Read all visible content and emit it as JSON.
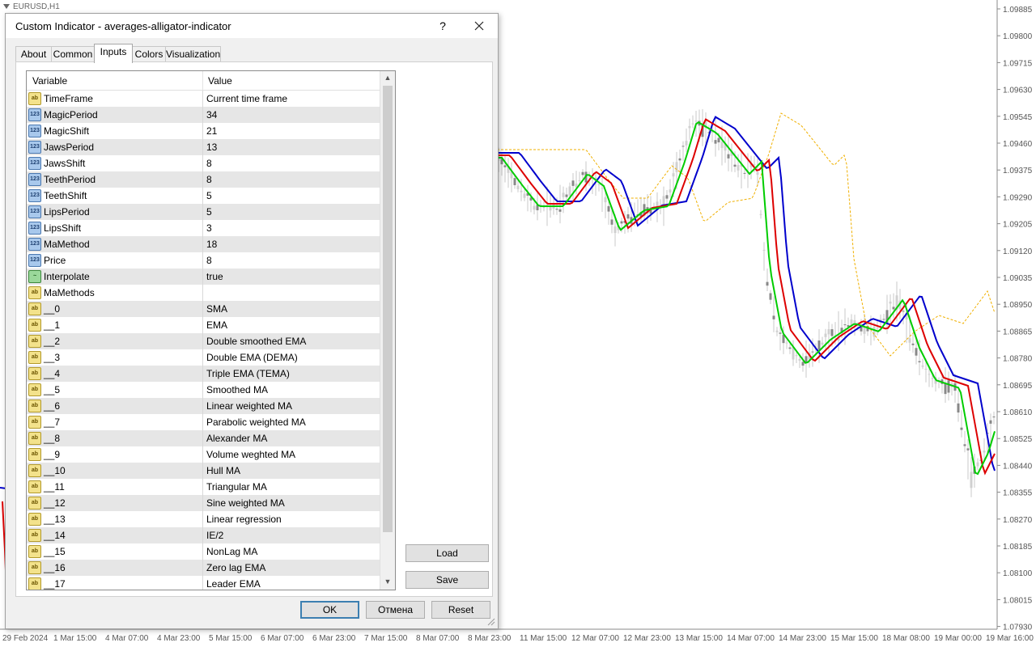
{
  "chart": {
    "symbol": "EURUSD,H1",
    "price_labels": [
      "1.09885",
      "1.09800",
      "1.09715",
      "1.09630",
      "1.09545",
      "1.09460",
      "1.09375",
      "1.09290",
      "1.09205",
      "1.09120",
      "1.09035",
      "1.08950",
      "1.08865",
      "1.08780",
      "1.08695",
      "1.08610",
      "1.08525",
      "1.08440",
      "1.08355",
      "1.08270",
      "1.08185",
      "1.08100",
      "1.08015",
      "1.07930"
    ],
    "time_labels": [
      "29 Feb 2024",
      "1 Mar 15:00",
      "4 Mar 07:00",
      "4 Mar 23:00",
      "5 Mar 15:00",
      "6 Mar 07:00",
      "6 Mar 23:00",
      "7 Mar 15:00",
      "8 Mar 07:00",
      "8 Mar 23:00",
      "11 Mar 15:00",
      "12 Mar 07:00",
      "12 Mar 23:00",
      "13 Mar 15:00",
      "14 Mar 07:00",
      "14 Mar 23:00",
      "15 Mar 15:00",
      "18 Mar 08:00",
      "19 Mar 00:00",
      "19 Mar 16:00"
    ],
    "colors": {
      "slow": "#0000cc",
      "mid": "#dd0000",
      "fast": "#00cc00",
      "band": "#f0b000",
      "candles": "#808080"
    }
  },
  "dialog": {
    "title": "Custom Indicator - averages-alligator-indicator",
    "help_label": "?",
    "tabs": [
      "About",
      "Common",
      "Inputs",
      "Colors",
      "Visualization"
    ],
    "active_tab": "Inputs",
    "columns": {
      "variable": "Variable",
      "value": "Value"
    },
    "params": [
      {
        "icon": "ab",
        "name": "TimeFrame",
        "value": "Current time frame"
      },
      {
        "icon": "123",
        "name": "MagicPeriod",
        "value": "34"
      },
      {
        "icon": "123",
        "name": "MagicShift",
        "value": "21"
      },
      {
        "icon": "123",
        "name": "JawsPeriod",
        "value": "13"
      },
      {
        "icon": "123",
        "name": "JawsShift",
        "value": "8"
      },
      {
        "icon": "123",
        "name": "TeethPeriod",
        "value": "8"
      },
      {
        "icon": "123",
        "name": "TeethShift",
        "value": "5"
      },
      {
        "icon": "123",
        "name": "LipsPeriod",
        "value": "5"
      },
      {
        "icon": "123",
        "name": "LipsShift",
        "value": "3"
      },
      {
        "icon": "123",
        "name": "MaMethod",
        "value": "18"
      },
      {
        "icon": "123",
        "name": "Price",
        "value": "8"
      },
      {
        "icon": "bool",
        "name": "Interpolate",
        "value": "true"
      },
      {
        "icon": "ab",
        "name": "MaMethods",
        "value": ""
      },
      {
        "icon": "ab",
        "name": "__0",
        "value": "SMA"
      },
      {
        "icon": "ab",
        "name": "__1",
        "value": "EMA"
      },
      {
        "icon": "ab",
        "name": "__2",
        "value": "Double smoothed EMA"
      },
      {
        "icon": "ab",
        "name": "__3",
        "value": "Double EMA (DEMA)"
      },
      {
        "icon": "ab",
        "name": "__4",
        "value": "Triple EMA (TEMA)"
      },
      {
        "icon": "ab",
        "name": "__5",
        "value": "Smoothed MA"
      },
      {
        "icon": "ab",
        "name": "__6",
        "value": "Linear weighted MA"
      },
      {
        "icon": "ab",
        "name": "__7",
        "value": "Parabolic weighted MA"
      },
      {
        "icon": "ab",
        "name": "__8",
        "value": "Alexander MA"
      },
      {
        "icon": "ab",
        "name": "__9",
        "value": "Volume weghted MA"
      },
      {
        "icon": "ab",
        "name": "__10",
        "value": "Hull MA"
      },
      {
        "icon": "ab",
        "name": "__11",
        "value": "Triangular MA"
      },
      {
        "icon": "ab",
        "name": "__12",
        "value": "Sine weighted MA"
      },
      {
        "icon": "ab",
        "name": "__13",
        "value": "Linear regression"
      },
      {
        "icon": "ab",
        "name": "__14",
        "value": "IE/2"
      },
      {
        "icon": "ab",
        "name": "__15",
        "value": "NonLag MA"
      },
      {
        "icon": "ab",
        "name": "__16",
        "value": "Zero lag EMA"
      },
      {
        "icon": "ab",
        "name": "__17",
        "value": "Leader EMA"
      }
    ],
    "buttons": {
      "load": "Load",
      "save": "Save",
      "ok": "OK",
      "cancel": "Отмена",
      "reset": "Reset"
    }
  }
}
